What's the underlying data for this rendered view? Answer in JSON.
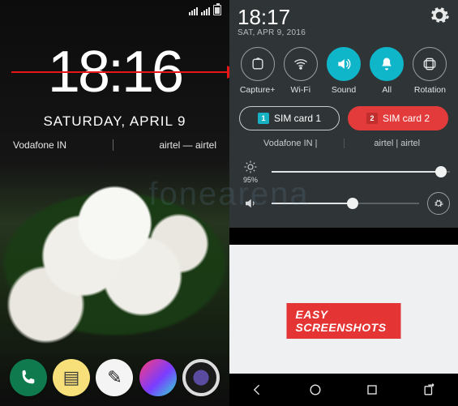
{
  "watermark": "fonearena",
  "promo_text": "EASY SCREENSHOTS",
  "left": {
    "time": "18:16",
    "date": "SATURDAY, APRIL 9",
    "carrier1": "Vodafone IN",
    "carrier2": "airtel — airtel",
    "dock": {
      "phone": "phone-icon",
      "note": "note-icon",
      "pen": "pen-icon",
      "gallery": "gallery-icon",
      "camera": "camera-icon"
    }
  },
  "right": {
    "time": "18:17",
    "date": "SAT, APR 9, 2016",
    "settings_icon": "gear-icon",
    "qs": [
      {
        "name": "capture-plus",
        "label": "Capture+",
        "active": false
      },
      {
        "name": "wifi",
        "label": "Wi-Fi",
        "active": false
      },
      {
        "name": "sound",
        "label": "Sound",
        "active": true
      },
      {
        "name": "all",
        "label": "All",
        "active": true
      },
      {
        "name": "rotation",
        "label": "Rotation",
        "active": false
      }
    ],
    "sim1": {
      "badge": "1",
      "label": "SIM card 1"
    },
    "sim2": {
      "badge": "2",
      "label": "SIM card 2"
    },
    "carrier_line1": "Vodafone IN |",
    "carrier_line2": "airtel | airtel",
    "brightness": {
      "percent_label": "95%",
      "value": 95
    },
    "volume": {
      "value": 55
    },
    "nav": {
      "back": "back-icon",
      "home": "home-icon",
      "recent": "recent-icon",
      "sim_switch": "sim-switch-icon"
    }
  }
}
